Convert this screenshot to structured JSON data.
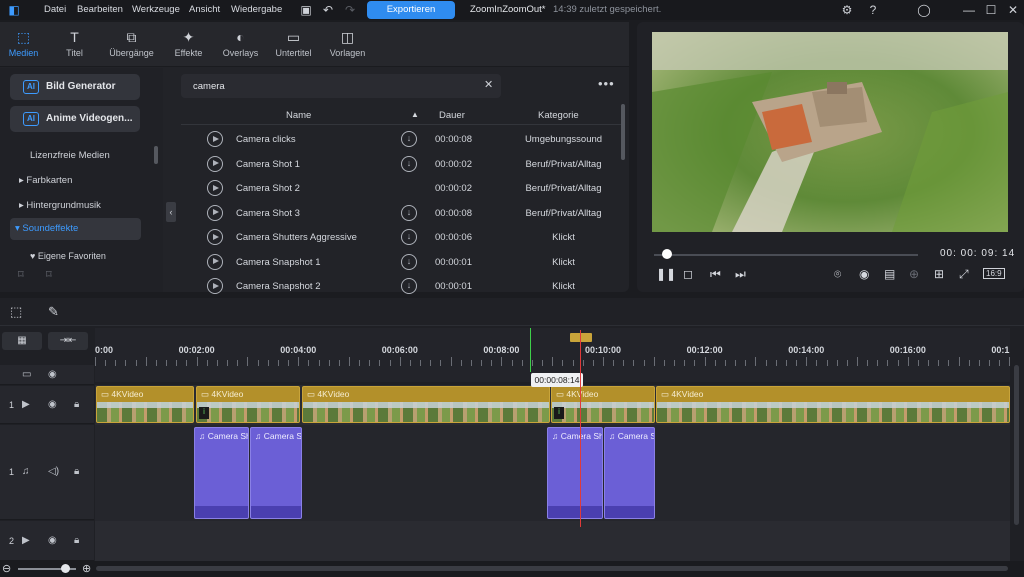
{
  "menu": {
    "items": [
      "Datei",
      "Bearbeiten",
      "Werkzeuge",
      "Ansicht",
      "Wiedergabe"
    ],
    "export_label": "Exportieren",
    "project_name": "ZoomInZoomOut*",
    "saved_info": "14:39 zuletzt gespeichert."
  },
  "tabs": [
    {
      "label": "Medien",
      "icon": "media-icon"
    },
    {
      "label": "Titel",
      "icon": "title-icon"
    },
    {
      "label": "Übergänge",
      "icon": "transitions-icon"
    },
    {
      "label": "Effekte",
      "icon": "effects-icon"
    },
    {
      "label": "Overlays",
      "icon": "overlays-icon"
    },
    {
      "label": "Untertitel",
      "icon": "subtitles-icon"
    },
    {
      "label": "Vorlagen",
      "icon": "templates-icon"
    }
  ],
  "left_nav": {
    "ai_buttons": [
      "Bild Generator",
      "Anime Videogen..."
    ],
    "royalty_free": "Lizenzfreie Medien",
    "items": [
      "Farbkarten",
      "Hintergrundmusik"
    ],
    "selected": "Soundeffekte",
    "sub_item": "Eigene Favoriten"
  },
  "search": {
    "value": "camera"
  },
  "list": {
    "headers": {
      "name": "Name",
      "duration": "Dauer",
      "category": "Kategorie"
    },
    "rows": [
      {
        "name": "Camera clicks",
        "duration": "00:00:08",
        "category": "Umgebungssound",
        "download": true
      },
      {
        "name": "Camera Shot 1",
        "duration": "00:00:02",
        "category": "Beruf/Privat/Alltag",
        "download": true
      },
      {
        "name": "Camera Shot 2",
        "duration": "00:00:02",
        "category": "Beruf/Privat/Alltag",
        "download": false
      },
      {
        "name": "Camera Shot 3",
        "duration": "00:00:08",
        "category": "Beruf/Privat/Alltag",
        "download": true
      },
      {
        "name": "Camera Shutters Aggressive",
        "duration": "00:00:06",
        "category": "Klickt",
        "download": true
      },
      {
        "name": "Camera Snapshot 1",
        "duration": "00:00:01",
        "category": "Klickt",
        "download": true
      },
      {
        "name": "Camera Snapshot 2",
        "duration": "00:00:01",
        "category": "Klickt",
        "download": true
      }
    ]
  },
  "preview": {
    "timecode": "00: 00: 09: 14",
    "aspect": "16:9",
    "progress": 0.04
  },
  "timeline": {
    "ruler_labels": [
      "0:00",
      "00:02:00",
      "00:04:00",
      "00:06:00",
      "00:08:00",
      "00:10:00",
      "00:12:00",
      "00:14:00",
      "00:16:00",
      "00:1"
    ],
    "cursor_time": "00:00:08:14",
    "tracks": [
      "1",
      "1",
      "2"
    ],
    "video_clip_label": "4KVideo",
    "audio_clips": [
      "Camera Sh",
      "Camera S",
      "Camera Sh",
      "Camera S"
    ]
  },
  "colors": {
    "accent": "#2f8cf0",
    "video_clip": "#b3902a",
    "audio_clip": "#6b5fd6",
    "playhead": "#e03a3a"
  }
}
